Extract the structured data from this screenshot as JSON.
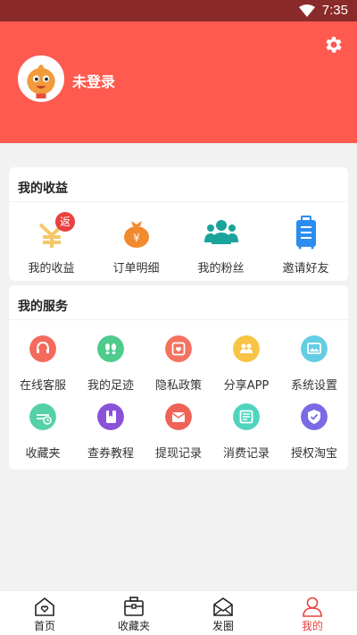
{
  "status_bar": {
    "time": "7:35"
  },
  "header": {
    "user_name": "未登录"
  },
  "income": {
    "title": "我的收益",
    "badge": "返",
    "items": [
      {
        "label": "我的收益",
        "icon": "yen-icon"
      },
      {
        "label": "订单明细",
        "icon": "money-bag-icon"
      },
      {
        "label": "我的粉丝",
        "icon": "fans-icon"
      },
      {
        "label": "邀请好友",
        "icon": "luggage-icon"
      }
    ]
  },
  "service": {
    "title": "我的服务",
    "items": [
      {
        "label": "在线客服",
        "icon": "customer-service-icon",
        "color": "#f36b5d"
      },
      {
        "label": "我的足迹",
        "icon": "footprint-icon",
        "color": "#4ecb8d"
      },
      {
        "label": "隐私政策",
        "icon": "privacy-icon",
        "color": "#f4725f"
      },
      {
        "label": "分享APP",
        "icon": "share-icon",
        "color": "#f7c445"
      },
      {
        "label": "系统设置",
        "icon": "system-settings-icon",
        "color": "#63cde3"
      },
      {
        "label": "收藏夹",
        "icon": "favorites-icon",
        "color": "#55d0a8"
      },
      {
        "label": "查券教程",
        "icon": "tutorial-icon",
        "color": "#8a52d8"
      },
      {
        "label": "提现记录",
        "icon": "withdraw-icon",
        "color": "#ef6357"
      },
      {
        "label": "消费记录",
        "icon": "consumption-icon",
        "color": "#4fd4be"
      },
      {
        "label": "授权淘宝",
        "icon": "authorize-icon",
        "color": "#7b6ae6"
      }
    ]
  },
  "tabbar": {
    "items": [
      {
        "label": "首页",
        "icon": "home-icon"
      },
      {
        "label": "收藏夹",
        "icon": "briefcase-icon"
      },
      {
        "label": "发圈",
        "icon": "envelope-icon"
      },
      {
        "label": "我的",
        "icon": "profile-icon"
      }
    ],
    "active": "我的",
    "active_color": "#e8413e"
  },
  "colors": {
    "header": "#ff5a50",
    "status_bar": "#8b2a2a"
  }
}
